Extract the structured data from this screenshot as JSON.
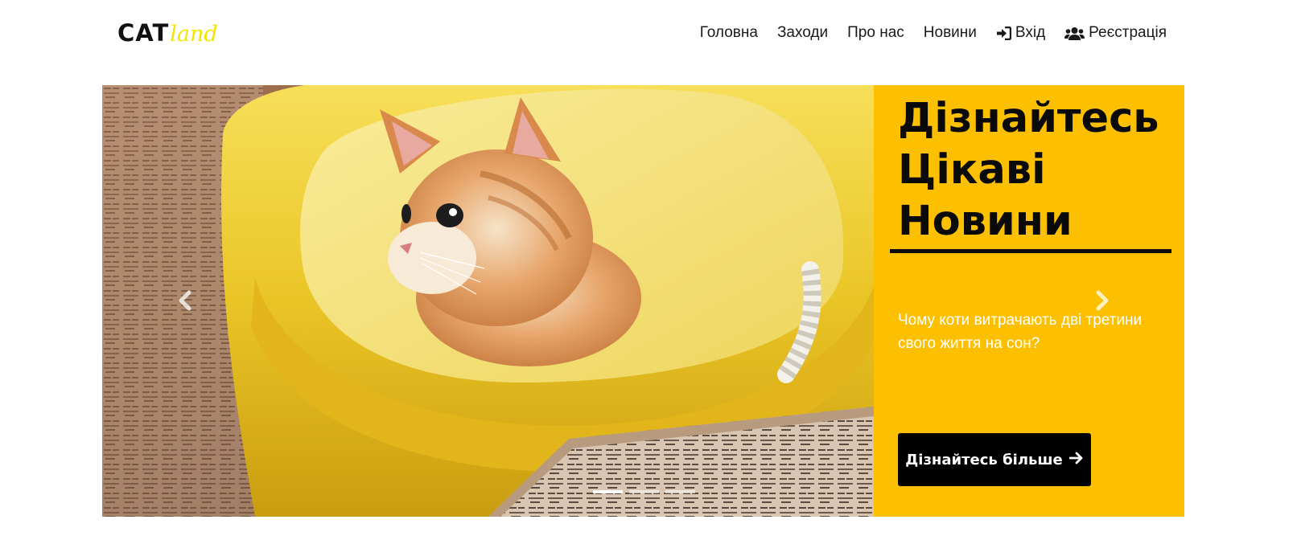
{
  "brand": {
    "part1": "CAT",
    "part2": "land",
    "accent": "#f2e500"
  },
  "nav": {
    "items": [
      {
        "label": "Головна"
      },
      {
        "label": "Заходи"
      },
      {
        "label": "Про нас"
      },
      {
        "label": "Новини"
      },
      {
        "label": "Вхід",
        "icon": "sign-in-icon"
      },
      {
        "label": "Реєстрація",
        "icon": "users-icon"
      }
    ]
  },
  "hero": {
    "panel_color": "#fcc000",
    "title_line1": "Дізнайтесь",
    "title_line2": "Цікаві",
    "title_line3": "Новини",
    "text": "Чому коти витрачають дві третини свого життя на сон?",
    "cta_label": "Дізнайтесь більше",
    "slides_count": 3,
    "active_slide": 1,
    "image_description_icon": "kitten-photo"
  }
}
